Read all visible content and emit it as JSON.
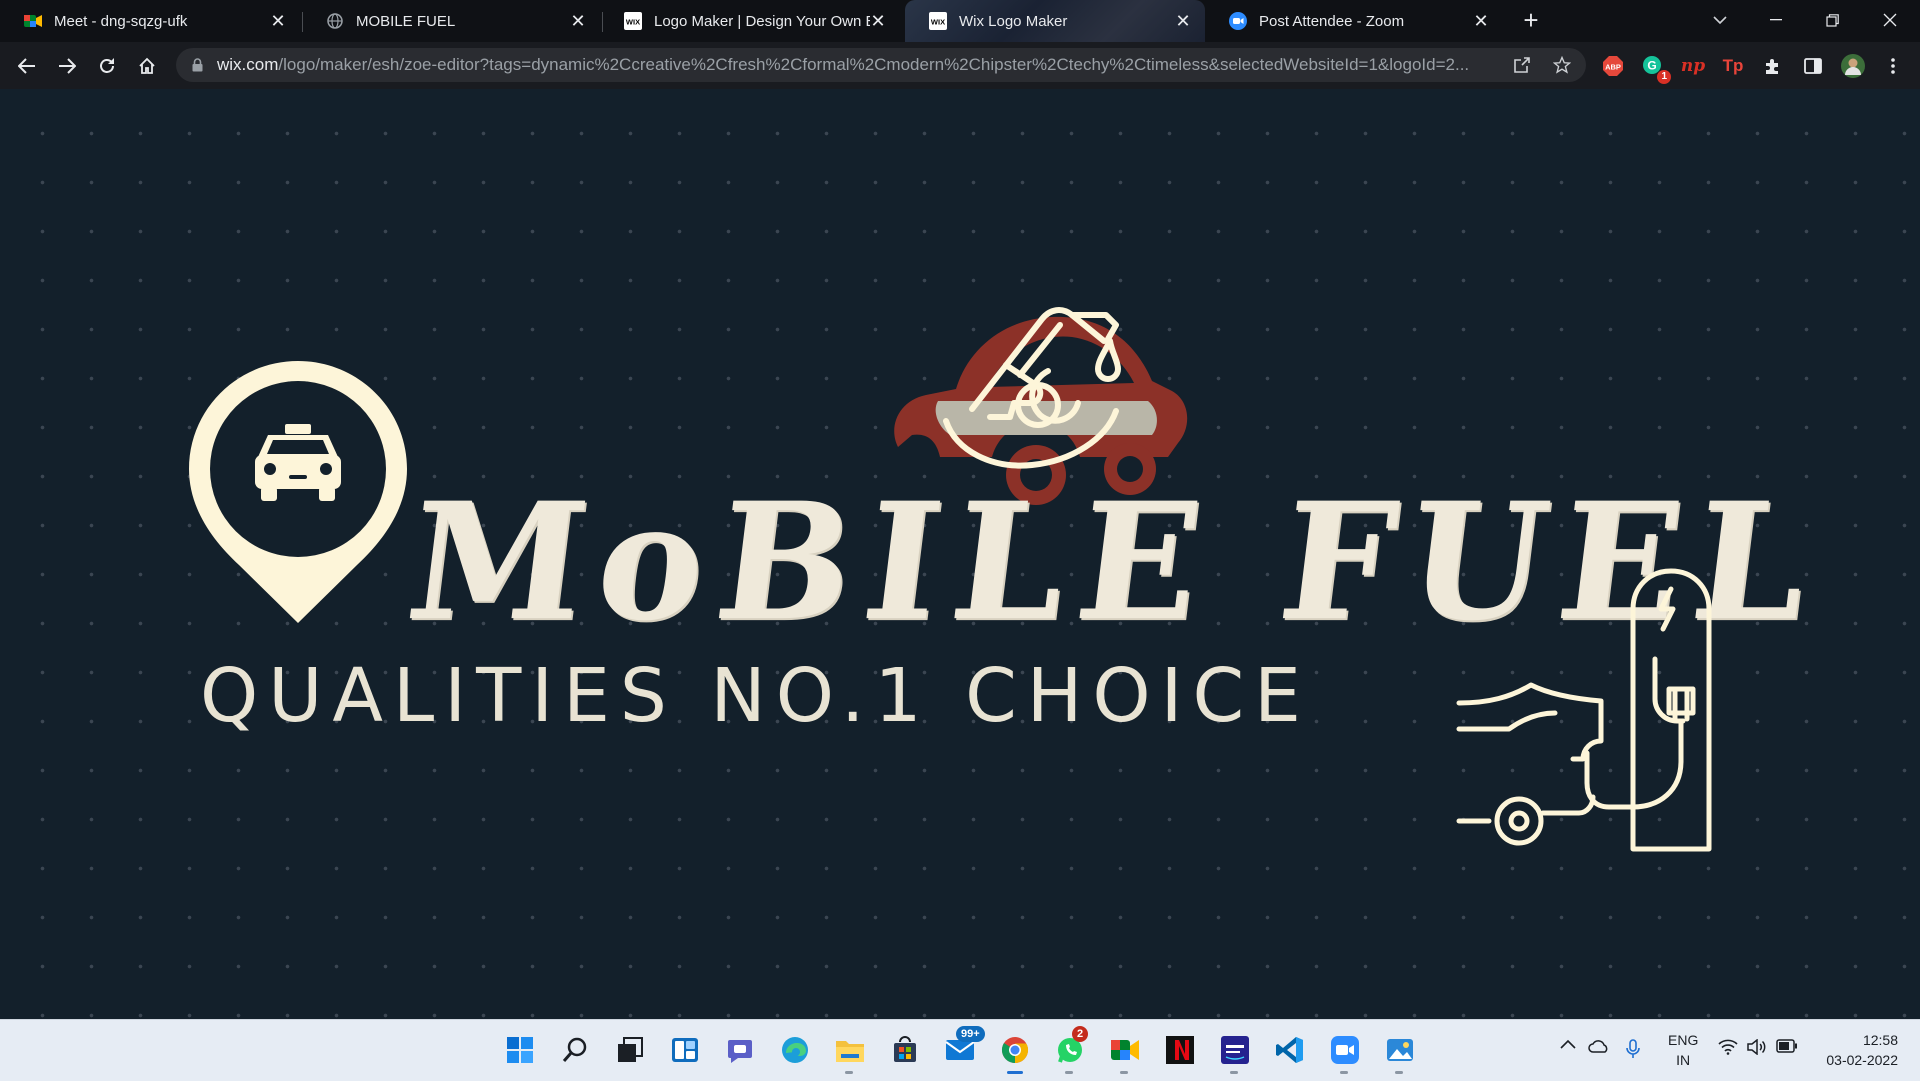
{
  "browser": {
    "tabs": [
      {
        "title": "Meet - dng-sqzg-ufk",
        "icon": "google-meet-icon"
      },
      {
        "title": "MOBILE FUEL",
        "icon": "globe-icon"
      },
      {
        "title": "Logo Maker | Design Your Own B",
        "icon": "wix-icon"
      },
      {
        "title": "Wix Logo Maker",
        "icon": "wix-icon",
        "active": true
      },
      {
        "title": "Post Attendee - Zoom",
        "icon": "zoom-icon"
      }
    ],
    "url_host": "wix.com",
    "url_path": "/logo/maker/esh/zoe-editor?tags=dynamic%2Ccreative%2Cfresh%2Cformal%2Cmodern%2Chipster%2Ctechy%2Ctimeless&selectedWebsiteId=1&logoId=2...",
    "extensions": [
      {
        "name": "ABP",
        "badge": ""
      },
      {
        "name": "grammarly",
        "badge": "1"
      },
      {
        "name": "np",
        "badge": ""
      },
      {
        "name": "Tp",
        "badge": ""
      }
    ]
  },
  "logo": {
    "headline": "MoBILE FUEL",
    "tagline": "QUALITIES NO.1 CHOICE",
    "colors": {
      "cream": "#fdf5d9",
      "car_red": "#8c3128",
      "car_grey": "#b9b6a8",
      "background": "#13202b"
    }
  },
  "taskbar": {
    "mail_badge": "99+",
    "whatsapp_badge": "2",
    "lang_line1": "ENG",
    "lang_line2": "IN",
    "time": "12:58",
    "date": "03-02-2022"
  }
}
